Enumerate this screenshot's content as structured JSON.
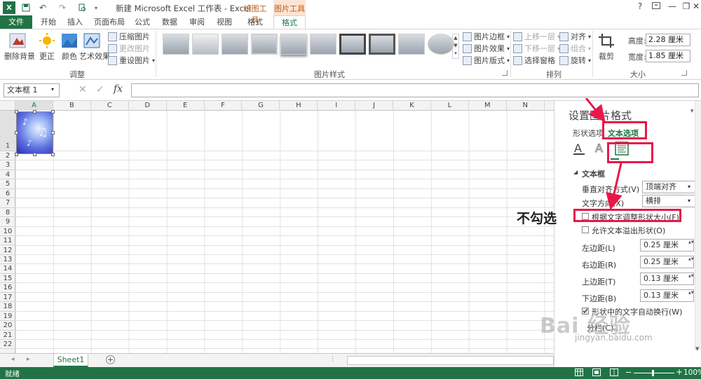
{
  "title_bar": {
    "title": "新建 Microsoft Excel 工作表 - Excel",
    "context_groups": [
      "绘图工具",
      "图片工具"
    ],
    "help": "?",
    "minimize": "—",
    "restore": "❐",
    "close": "✕"
  },
  "tabs": [
    {
      "label": "文件"
    },
    {
      "label": "开始"
    },
    {
      "label": "插入"
    },
    {
      "label": "页面布局"
    },
    {
      "label": "公式"
    },
    {
      "label": "数据"
    },
    {
      "label": "审阅"
    },
    {
      "label": "视图"
    },
    {
      "label": "格式"
    },
    {
      "label": "格式"
    }
  ],
  "ribbon": {
    "remove_bg": "删除背景",
    "correct": "更正",
    "color": "颜色",
    "artistic": "艺术效果",
    "compress": "压缩图片",
    "change": "更改图片",
    "reset": "重设图片",
    "adjust_group": "调整",
    "styles_group": "图片样式",
    "border": "图片边框",
    "effects": "图片效果",
    "layout": "图片版式",
    "bring_forward": "上移一层",
    "send_backward": "下移一层",
    "selection_pane": "选择窗格",
    "align": "对齐",
    "group": "组合",
    "rotate": "旋转",
    "arrange_group": "排列",
    "crop": "裁剪",
    "height_label": "高度:",
    "height_value": "2.28 厘米",
    "width_label": "宽度:",
    "width_value": "1.85 厘米",
    "size_group": "大小"
  },
  "formula_bar": {
    "name_box": "文本框 1",
    "fx": "fx",
    "cancel": "✕",
    "enter": "✓"
  },
  "grid": {
    "columns": [
      "A",
      "B",
      "C",
      "D",
      "E",
      "F",
      "G",
      "H",
      "I",
      "J",
      "K",
      "L",
      "M",
      "N"
    ],
    "rows": [
      "1",
      "2",
      "3",
      "4",
      "5",
      "6",
      "7",
      "8",
      "9",
      "10",
      "11",
      "12",
      "13",
      "14",
      "15",
      "16",
      "17",
      "18",
      "19",
      "20",
      "21",
      "22"
    ]
  },
  "sheet_tabs": {
    "sheet1": "Sheet1",
    "add": "+"
  },
  "status_bar": {
    "ready": "就绪",
    "zoom": "100%"
  },
  "task_pane": {
    "title": "设置图片格式",
    "tab_shape": "形状选项",
    "tab_text": "文本选项",
    "section": "文本框",
    "valign_label": "垂直对齐方式(V)",
    "valign_value": "顶端对齐",
    "direction_label": "文字方向(X)",
    "direction_value": "横排",
    "autofit_label": "根据文字调整形状大小(F)",
    "overflow_label": "允许文本溢出形状(O)",
    "left_margin_label": "左边距(L)",
    "left_margin_value": "0.25 厘米",
    "right_margin_label": "右边距(R)",
    "right_margin_value": "0.25 厘米",
    "top_margin_label": "上边距(T)",
    "top_margin_value": "0.13 厘米",
    "bottom_margin_label": "下边距(B)",
    "bottom_margin_value": "0.13 厘米",
    "wrap_label": "形状中的文字自动换行(W)",
    "columns_label": "分栏(C)..."
  },
  "annotation": {
    "text": "不勾选",
    "color": "#e8174a"
  },
  "watermark": {
    "text": "Bai 经验",
    "url": "jingyan.baidu.com"
  },
  "colors": {
    "excel_green": "#217346",
    "context_orange": "#c55a11"
  }
}
